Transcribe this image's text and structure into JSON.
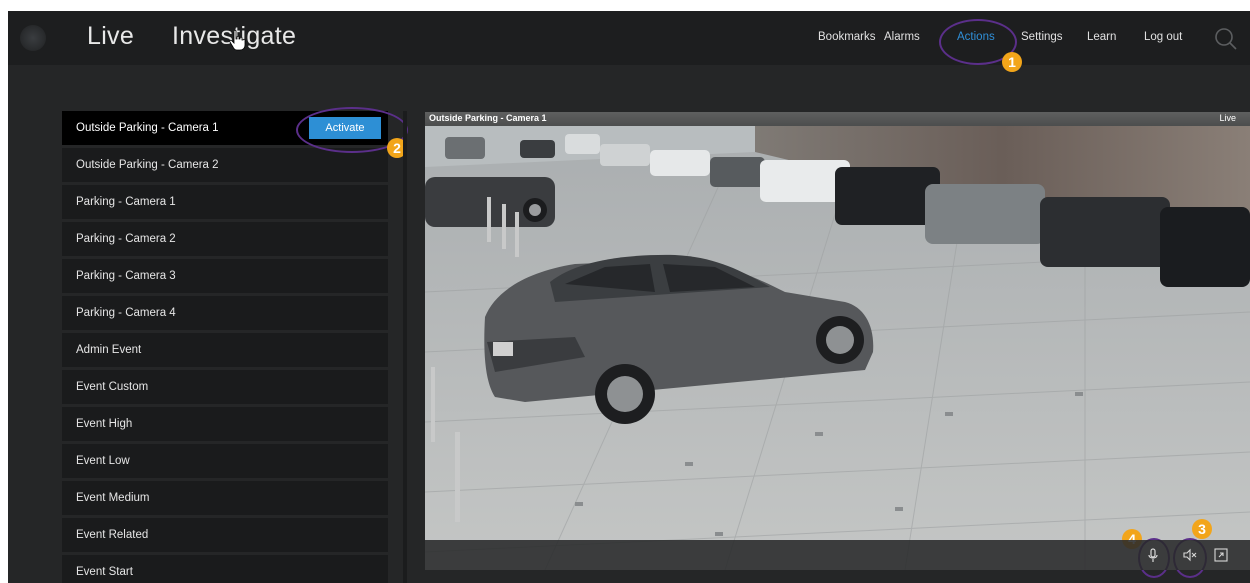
{
  "header": {
    "tabs": [
      {
        "label": "Live"
      },
      {
        "label": "Investigate"
      }
    ],
    "nav": [
      {
        "label": "Bookmarks"
      },
      {
        "label": "Alarms"
      },
      {
        "label": "Actions",
        "active": true
      },
      {
        "label": "Settings"
      },
      {
        "label": "Learn"
      },
      {
        "label": "Log out"
      }
    ],
    "search_icon": "search-icon"
  },
  "callouts": [
    "1",
    "2",
    "3",
    "4"
  ],
  "actions_list": {
    "activate_label": "Activate",
    "items": [
      {
        "label": "Outside Parking - Camera 1",
        "selected": true
      },
      {
        "label": "Outside Parking - Camera 2"
      },
      {
        "label": "Parking - Camera 1"
      },
      {
        "label": "Parking - Camera 2"
      },
      {
        "label": "Parking - Camera 3"
      },
      {
        "label": "Parking - Camera 4"
      },
      {
        "label": "Admin Event"
      },
      {
        "label": "Event Custom"
      },
      {
        "label": "Event High"
      },
      {
        "label": "Event Low"
      },
      {
        "label": "Event Medium"
      },
      {
        "label": "Event Related"
      },
      {
        "label": "Event Start"
      }
    ]
  },
  "video": {
    "title": "Outside Parking - Camera 1",
    "status": "Live",
    "controls": [
      "microphone-icon",
      "speaker-muted-icon",
      "fullscreen-icon"
    ]
  },
  "colors": {
    "accent": "#2d8fd5",
    "callout": "#f2a51a",
    "highlight_ring": "#5b2f8a"
  }
}
